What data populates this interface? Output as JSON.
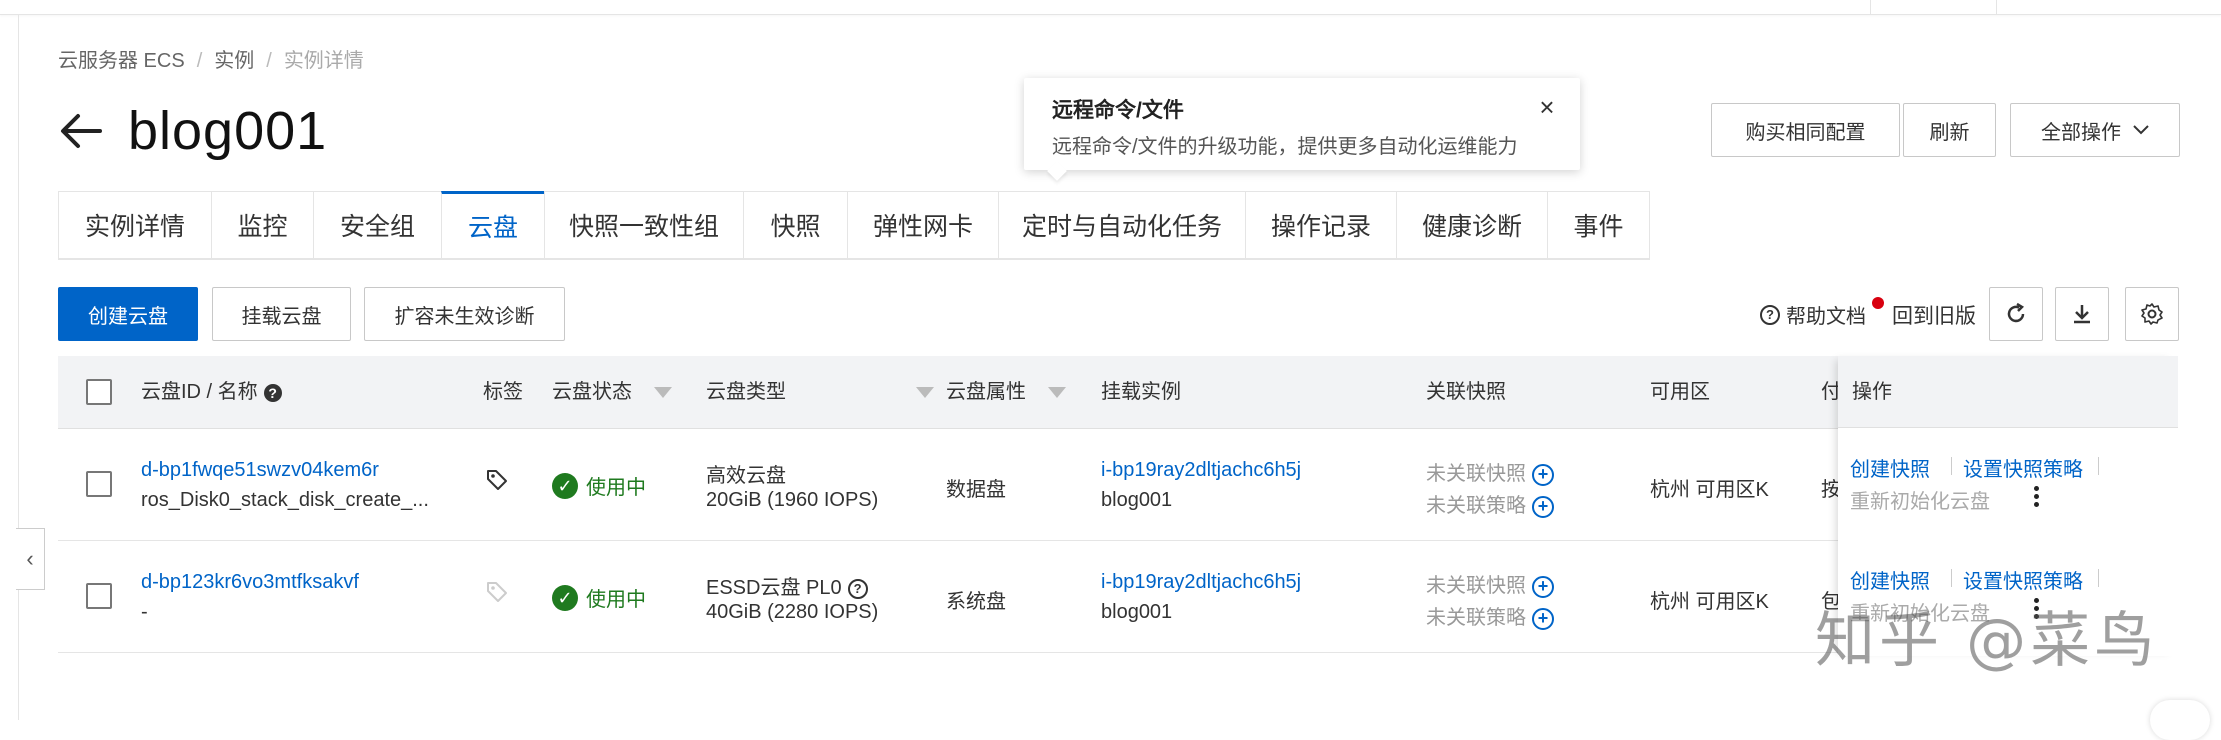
{
  "breadcrumb": {
    "item1": "云服务器 ECS",
    "item2": "实例",
    "current": "实例详情",
    "sep": "/"
  },
  "page": {
    "title": "blog001"
  },
  "popover": {
    "title": "远程命令/文件",
    "desc": "远程命令/文件的升级功能，提供更多自动化运维能力",
    "close": "×"
  },
  "header_buttons": {
    "buy_same": "购买相同配置",
    "refresh": "刷新",
    "all_ops": "全部操作"
  },
  "tabs": [
    "实例详情",
    "监控",
    "安全组",
    "云盘",
    "快照一致性组",
    "快照",
    "弹性网卡",
    "定时与自动化任务",
    "操作记录",
    "健康诊断",
    "事件"
  ],
  "active_tab": "云盘",
  "toolbar": {
    "create_disk": "创建云盘",
    "attach_disk": "挂载云盘",
    "expand_diag": "扩容未生效诊断",
    "help_doc": "帮助文档",
    "revert_old": "回到旧版"
  },
  "table": {
    "headers": {
      "id_name": "云盘ID / 名称",
      "tag": "标签",
      "status": "云盘状态",
      "type": "云盘类型",
      "attr": "云盘属性",
      "instance": "挂载实例",
      "snapshot": "关联快照",
      "zone": "可用区",
      "pay": "付",
      "ops": "操作"
    },
    "rows": [
      {
        "id": "d-bp1fwqe51swzv04kem6r",
        "name": "ros_Disk0_stack_disk_create_...",
        "status": "使用中",
        "type": "高效云盘",
        "spec": "20GiB (1960 IOPS)",
        "attr": "数据盘",
        "instance_id": "i-bp19ray2dltjachc6h5j",
        "instance_name": "blog001",
        "snap1": "未关联快照",
        "snap2": "未关联策略",
        "zone": "杭州 可用区K",
        "pay": "按",
        "op1": "创建快照",
        "op2": "设置快照策略",
        "op3": "重新初始化云盘"
      },
      {
        "id": "d-bp123kr6vo3mtfksakvf",
        "name": "-",
        "status": "使用中",
        "type": "ESSD云盘 PL0",
        "spec": "40GiB (2280 IOPS)",
        "attr": "系统盘",
        "instance_id": "i-bp19ray2dltjachc6h5j",
        "instance_name": "blog001",
        "snap1": "未关联快照",
        "snap2": "未关联策略",
        "zone": "杭州 可用区K",
        "pay": "包",
        "op1": "创建快照",
        "op2": "设置快照策略",
        "op3": "重新初始化云盘"
      }
    ]
  },
  "watermark": "知乎 @菜鸟",
  "colors": {
    "primary": "#0064c8",
    "success": "#1f7a1f",
    "danger": "#d8000f"
  }
}
